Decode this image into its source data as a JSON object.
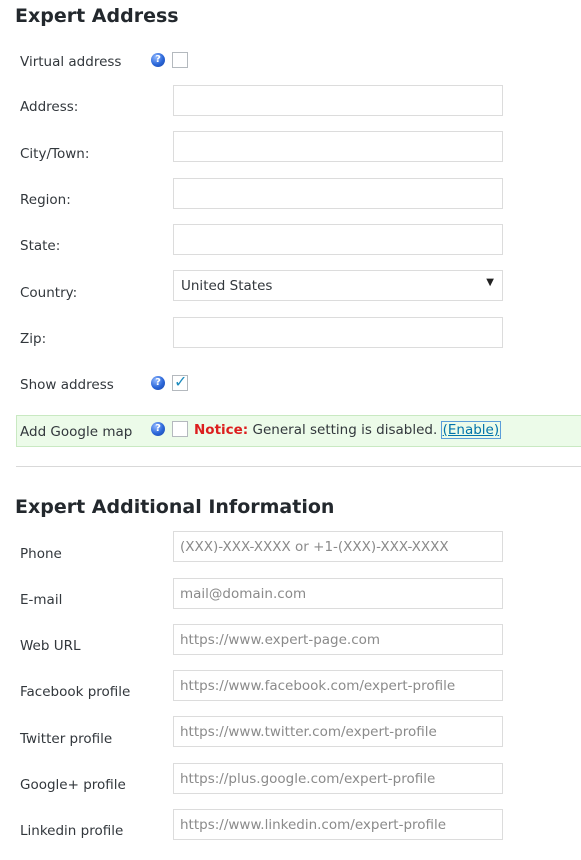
{
  "address_section": {
    "title": "Expert Address",
    "virtual_address_label": "Virtual address",
    "address_label": "Address:",
    "city_label": "City/Town:",
    "region_label": "Region:",
    "state_label": "State:",
    "country_label": "Country:",
    "country_value": "United States",
    "zip_label": "Zip:",
    "show_address_label": "Show address",
    "show_address_checked": true,
    "google_map_label": "Add Google map",
    "notice_label": "Notice:",
    "notice_text": "General setting is disabled.",
    "enable_link": "(Enable)"
  },
  "info_section": {
    "title": "Expert Additional Information",
    "fields": {
      "phone": {
        "label": "Phone",
        "placeholder": "(XXX)-XXX-XXXX or +1-(XXX)-XXX-XXXX"
      },
      "email": {
        "label": "E-mail",
        "placeholder": "mail@domain.com"
      },
      "web": {
        "label": "Web URL",
        "placeholder": "https://www.expert-page.com"
      },
      "facebook": {
        "label": "Facebook profile",
        "placeholder": "https://www.facebook.com/expert-profile"
      },
      "twitter": {
        "label": "Twitter profile",
        "placeholder": "https://www.twitter.com/expert-profile"
      },
      "google": {
        "label": "Google+ profile",
        "placeholder": "https://plus.google.com/expert-profile"
      },
      "linkedin": {
        "label": "Linkedin profile",
        "placeholder": "https://www.linkedin.com/expert-profile"
      }
    }
  },
  "icons": {
    "help": "help-icon",
    "dropdown": "chevron-down-icon",
    "check": "check-icon"
  },
  "colors": {
    "notice_red": "#dc1e1e",
    "link_blue": "#0073aa",
    "notice_bg": "#ecfbe9"
  }
}
